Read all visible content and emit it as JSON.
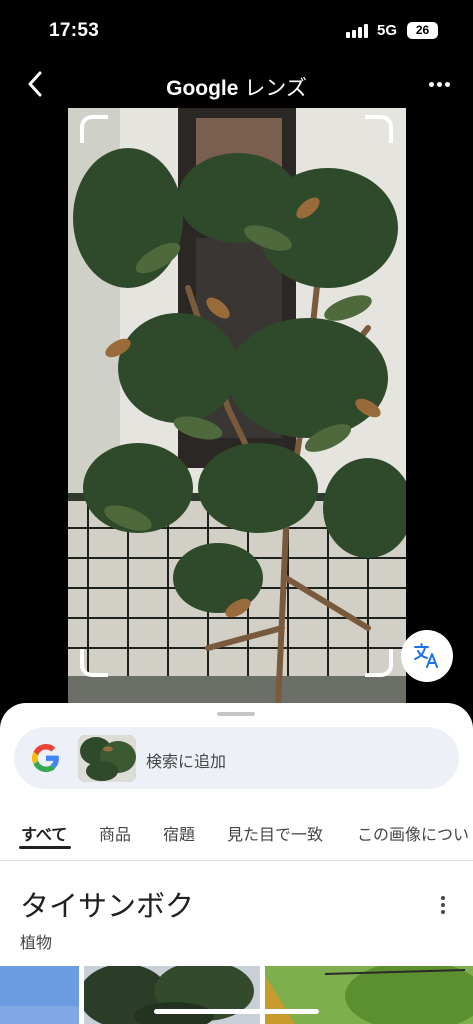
{
  "status_bar": {
    "time": "17:53",
    "network": "5G",
    "battery": "26"
  },
  "header": {
    "brand": "Google",
    "title_suffix": "レンズ",
    "back_icon": "chevron-left-icon",
    "more_icon": "more-horizontal-icon"
  },
  "translate_icon": "translate-icon",
  "search_bar": {
    "label": "検索に追加"
  },
  "tabs": [
    {
      "label": "すべて"
    },
    {
      "label": "商品"
    },
    {
      "label": "宿題"
    },
    {
      "label": "見た目で一致"
    },
    {
      "label": "この画像につい"
    }
  ],
  "result": {
    "title": "タイサンボク",
    "subtitle": "植物"
  },
  "colors": {
    "accent_blue": "#1a73e8",
    "google_blue": "#4285f4",
    "google_red": "#ea4335",
    "google_yellow": "#fbbc05",
    "google_green": "#34a853"
  }
}
